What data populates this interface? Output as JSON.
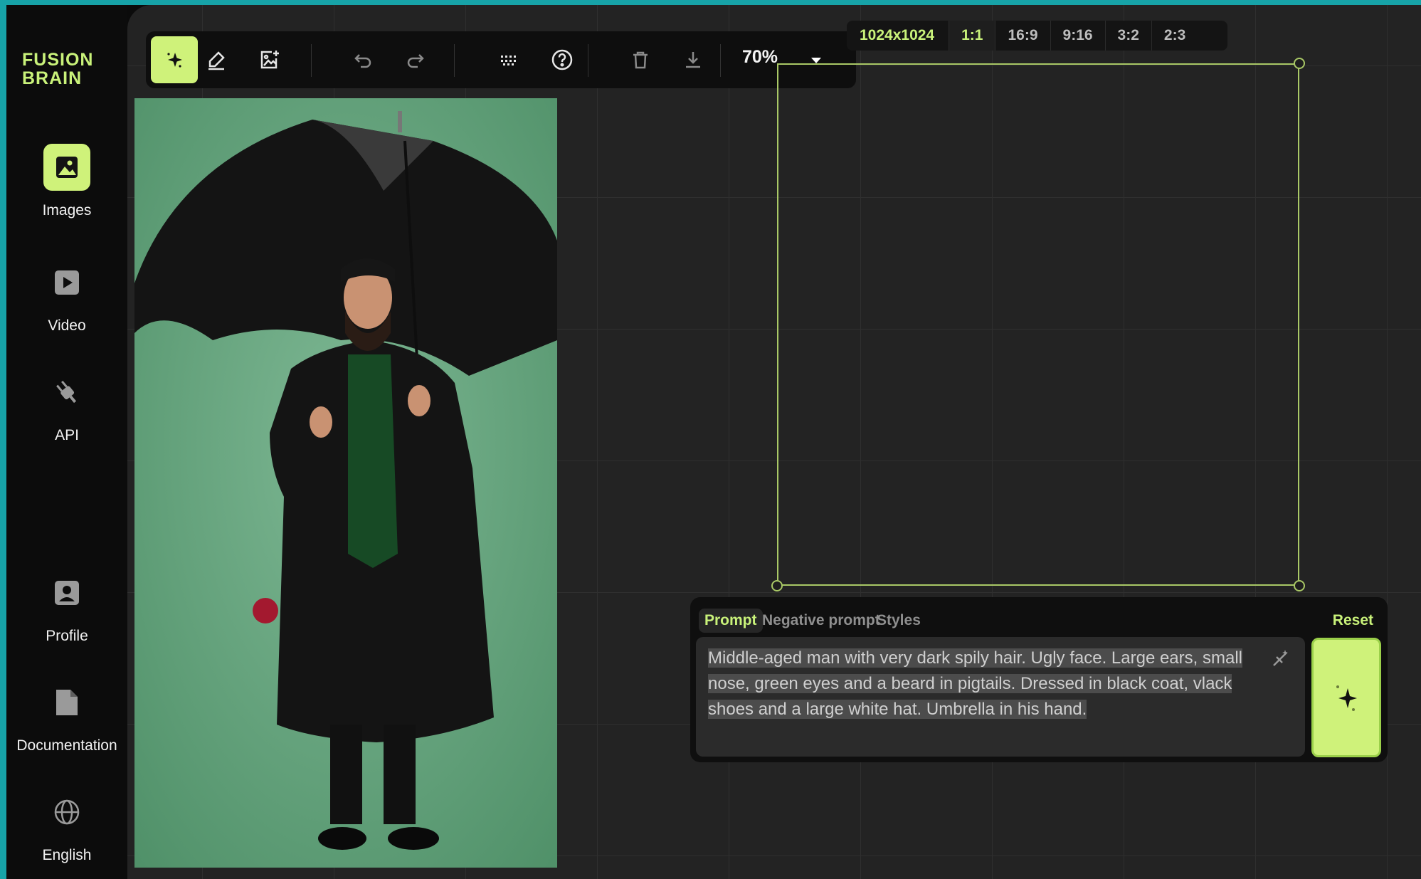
{
  "app": {
    "logo_line1": "FUSION",
    "logo_line2": "BRAIN",
    "accent": "#cff27a",
    "frame_color": "#17a3a8"
  },
  "sidebar": {
    "items": [
      {
        "label": "Images",
        "icon": "image-icon",
        "active": true
      },
      {
        "label": "Video",
        "icon": "video-icon",
        "active": false
      },
      {
        "label": "API",
        "icon": "plug-icon",
        "active": false
      },
      {
        "label": "Profile",
        "icon": "profile-icon",
        "active": false
      },
      {
        "label": "Documentation",
        "icon": "document-icon",
        "active": false
      },
      {
        "label": "English",
        "icon": "globe-icon",
        "active": false
      }
    ]
  },
  "toolbar": {
    "tools": [
      "generate-icon",
      "eraser-icon",
      "add-image-icon",
      "undo-icon",
      "redo-icon",
      "grid-icon",
      "help-icon",
      "trash-icon",
      "download-icon"
    ],
    "zoom": "70%"
  },
  "canvas": {
    "size": "1024x1024",
    "ratios": [
      "1:1",
      "16:9",
      "9:16",
      "3:2",
      "2:3"
    ],
    "active_ratio": "1:1"
  },
  "prompt_panel": {
    "tabs": [
      "Prompt",
      "Negative prompt",
      "Styles"
    ],
    "active_tab": "Prompt",
    "reset_label": "Reset",
    "prompt_text": "Middle-aged man with very dark spily hair. Ugly face. Large ears, small nose, green eyes and a beard in pigtails. Dressed in black coat, vlack shoes and a large white hat. Umbrella in his hand."
  }
}
